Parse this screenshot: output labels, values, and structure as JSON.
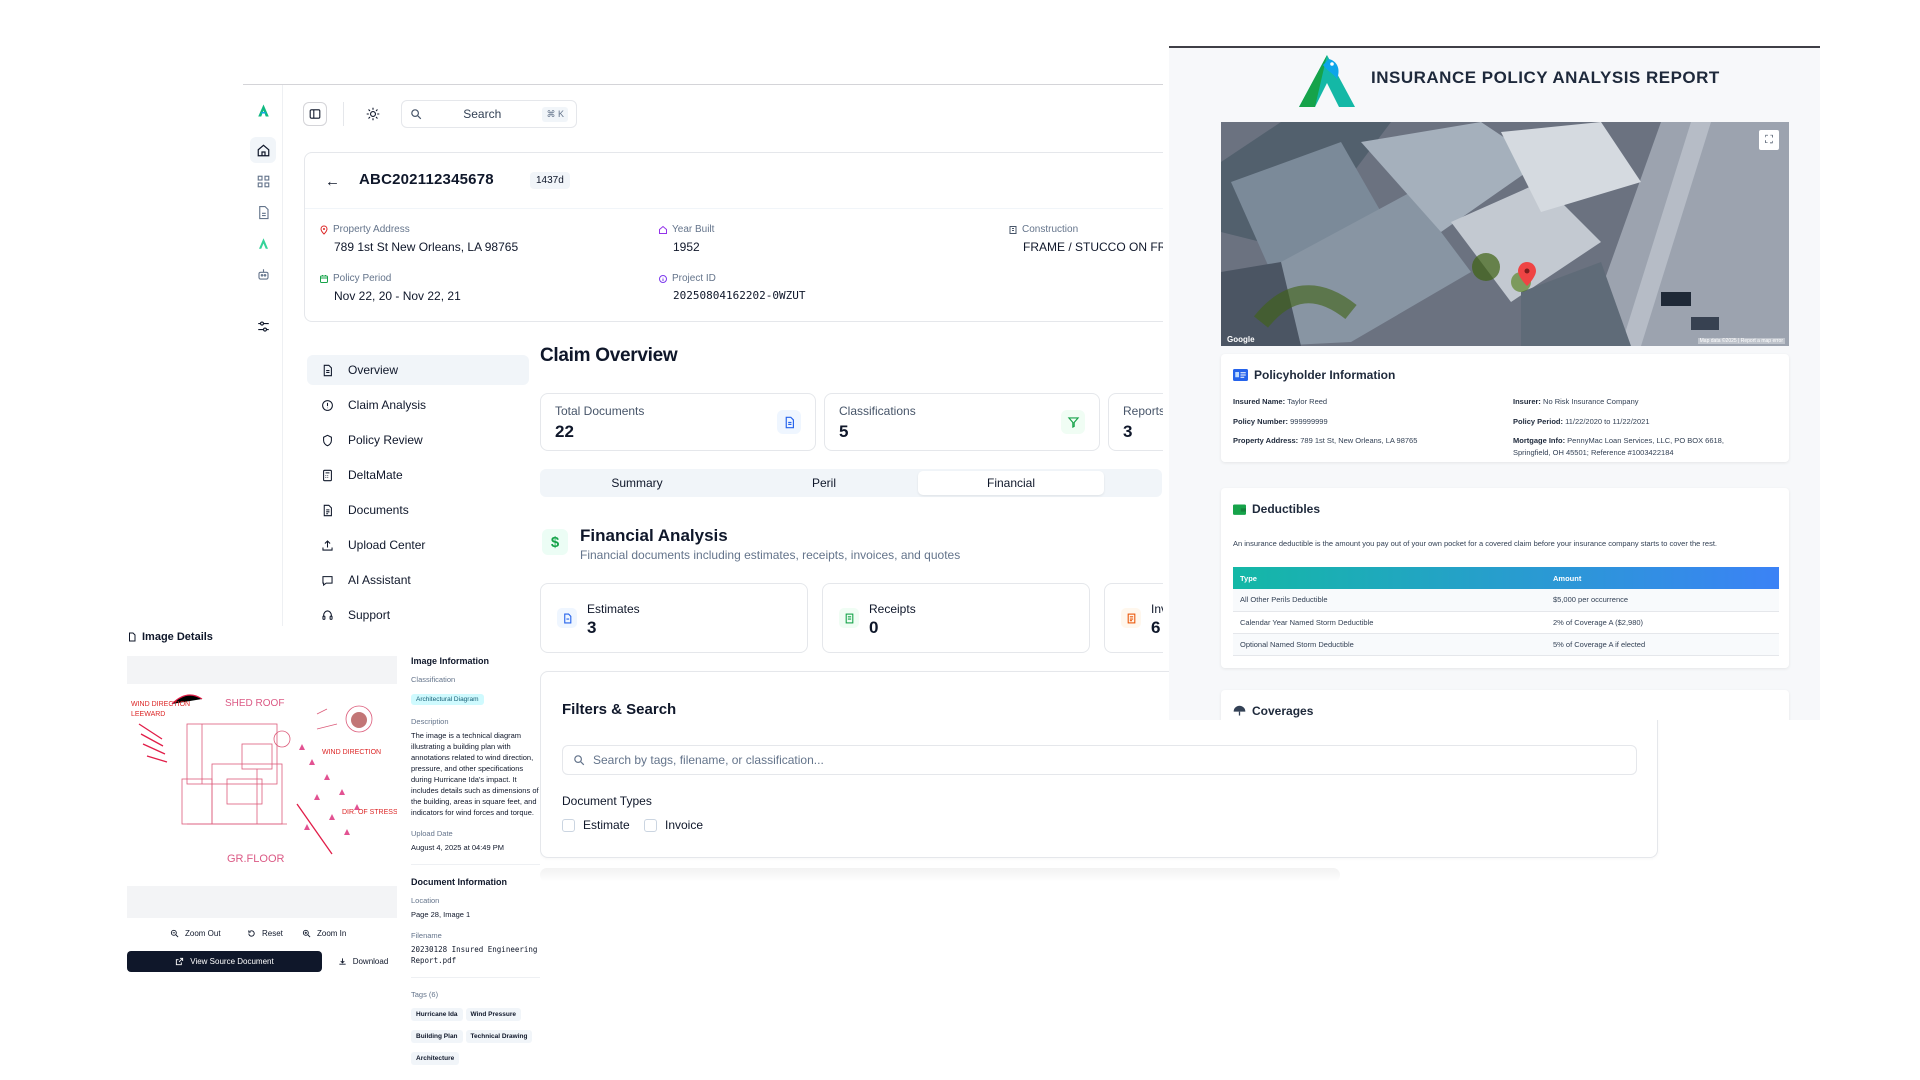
{
  "app": {
    "search": {
      "label": "Search",
      "shortcut": "⌘ K"
    },
    "claim": {
      "id": "ABC202112345678",
      "age_badge": "1437d",
      "fields": [
        {
          "label": "Property Address",
          "value": "789 1st St New Orleans, LA 98765",
          "color": "#dc2626"
        },
        {
          "label": "Year Built",
          "value": "1952",
          "color": "#9333ea"
        },
        {
          "label": "Construction",
          "value": "FRAME / STUCCO ON FRAI",
          "color": "#475569"
        },
        {
          "label": "Policy Period",
          "value": "Nov 22, 20 - Nov 22, 21",
          "color": "#16a34a"
        },
        {
          "label": "Project ID",
          "value": "20250804162202-0WZUT",
          "color": "#7c3aed"
        }
      ]
    },
    "nav": [
      {
        "label": "Overview",
        "icon": "document-icon",
        "active": true
      },
      {
        "label": "Claim Analysis",
        "icon": "alert-circle-icon"
      },
      {
        "label": "Policy Review",
        "icon": "shield-icon"
      },
      {
        "label": "DeltaMate",
        "icon": "calculator-icon"
      },
      {
        "label": "Documents",
        "icon": "file-text-icon"
      },
      {
        "label": "Upload Center",
        "icon": "upload-icon"
      },
      {
        "label": "AI Assistant",
        "icon": "chat-icon"
      },
      {
        "label": "Support",
        "icon": "headset-icon"
      }
    ],
    "overview": {
      "title": "Claim Overview",
      "stats": [
        {
          "label": "Total Documents",
          "value": "22",
          "icon": "document-icon",
          "color": "#2563eb",
          "bg": "#eff6ff"
        },
        {
          "label": "Classifications",
          "value": "5",
          "icon": "filter-icon",
          "color": "#16a34a",
          "bg": "#f0fdf4"
        },
        {
          "label": "Reports",
          "value": "3"
        }
      ],
      "tabs": [
        "Summary",
        "Peril",
        "Financial"
      ],
      "active_tab": "Financial"
    },
    "financial": {
      "icon": "$",
      "title": "Financial Analysis",
      "subtitle": "Financial documents including estimates, receipts, invoices, and quotes",
      "cards": [
        {
          "label": "Estimates",
          "value": "3",
          "icon": "estimate-icon",
          "color": "#2563eb",
          "bg": "#eff6ff"
        },
        {
          "label": "Receipts",
          "value": "0",
          "icon": "receipt-icon",
          "color": "#16a34a",
          "bg": "#f0fdf4"
        },
        {
          "label": "Inv",
          "value": "6",
          "icon": "invoice-icon",
          "color": "#ea580c",
          "bg": "#fff7ed"
        }
      ]
    },
    "filters": {
      "title": "Filters & Search",
      "placeholder": "Search by tags, filename, or classification...",
      "doc_types_label": "Document Types",
      "types": [
        "Estimate",
        "Invoice"
      ]
    }
  },
  "image_details": {
    "title": "Image Details",
    "zoom_out": "Zoom Out",
    "reset": "Reset",
    "zoom_in": "Zoom In",
    "view_source": "View Source Document",
    "download": "Download",
    "info_heading": "Image Information",
    "classification_label": "Classification",
    "classification": "Architectural Diagram",
    "description_label": "Description",
    "description": "The image is a technical diagram illustrating a building plan with annotations related to wind direction, pressure, and other specifications during Hurricane Ida's impact. It includes details such as dimensions of the building, areas in square feet, and indicators for wind forces and torque.",
    "upload_label": "Upload Date",
    "upload_date": "August 4, 2025 at 04:49 PM",
    "doc_heading": "Document Information",
    "location_label": "Location",
    "location": "Page 28, Image 1",
    "filename_label": "Filename",
    "filename": "20230128 Insured Engineering Report.pdf",
    "tags_label": "Tags (6)",
    "tags": [
      "Hurricane Ida",
      "Wind Pressure",
      "Building Plan",
      "Technical Drawing",
      "Architecture"
    ],
    "diagram_labels": [
      "SHED ROOF",
      "GR.FLOOR"
    ]
  },
  "report": {
    "title": "INSURANCE POLICY ANALYSIS REPORT",
    "map_google": "Google",
    "map_credit": "Map data ©2025 | Report a map error",
    "policyholder": {
      "title": "Policyholder Information",
      "rows": [
        {
          "k": "Insured Name:",
          "v": "Taylor Reed"
        },
        {
          "k": "Insurer:",
          "v": "No Risk Insurance Company"
        },
        {
          "k": "Policy Number:",
          "v": "999999999"
        },
        {
          "k": "Policy Period:",
          "v": "11/22/2020 to 11/22/2021"
        },
        {
          "k": "Property Address:",
          "v": "789 1st St, New Orleans, LA 98765"
        },
        {
          "k": "Mortgage Info:",
          "v": "PennyMac Loan Services, LLC, PO BOX 6618, Springfield, OH 45501; Reference #1003422184"
        }
      ]
    },
    "deductibles": {
      "title": "Deductibles",
      "description": "An insurance deductible is the amount you pay out of your own pocket for a covered claim before your insurance company starts to cover the rest.",
      "headers": [
        "Type",
        "Amount"
      ],
      "rows": [
        [
          "All Other Perils Deductible",
          "$5,000 per occurrence"
        ],
        [
          "Calendar Year Named Storm Deductible",
          "2% of Coverage A ($2,980)"
        ],
        [
          "Optional Named Storm Deductible",
          "5% of Coverage A if elected"
        ]
      ]
    },
    "coverages_title": "Coverages"
  }
}
